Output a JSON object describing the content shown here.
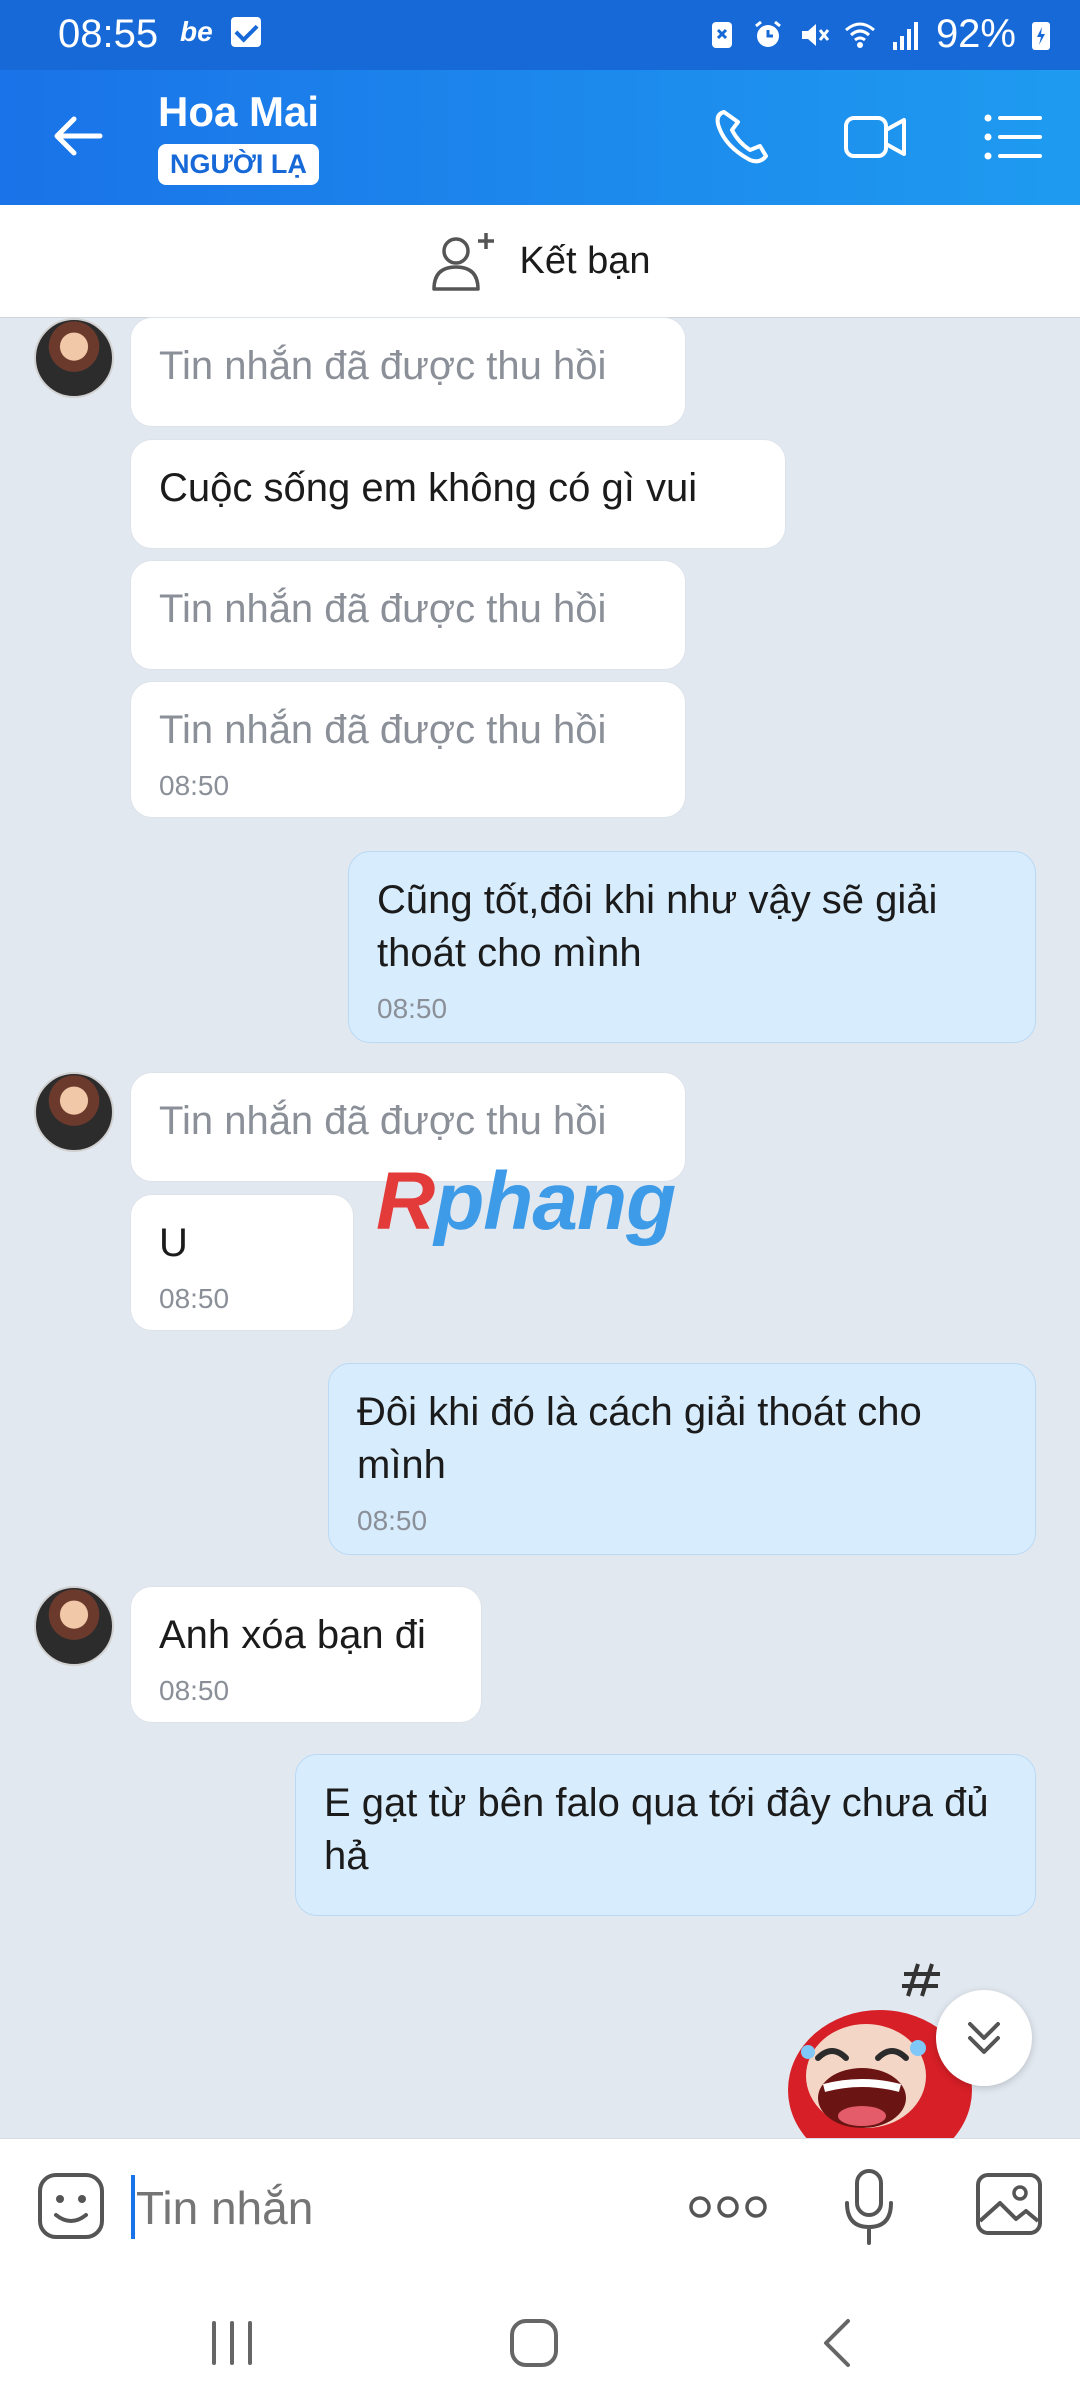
{
  "status_bar": {
    "time": "08:55",
    "be_label": "be",
    "battery": "92%"
  },
  "header": {
    "contact_name": "Hoa Mai",
    "badge": "NGƯỜI LẠ"
  },
  "friend_bar": {
    "label": "Kết bạn"
  },
  "messages": [
    {
      "side": "in",
      "text": "Tin nhắn đã được thu hồi",
      "time": "",
      "recalled": true
    },
    {
      "side": "in",
      "text": "Cuộc sống em không có gì vui",
      "time": "",
      "recalled": false
    },
    {
      "side": "in",
      "text": "Tin nhắn đã được thu hồi",
      "time": "",
      "recalled": true
    },
    {
      "side": "in",
      "text": "Tin nhắn đã được thu hồi",
      "time": "08:50",
      "recalled": true
    },
    {
      "side": "out",
      "text": "Cũng tốt,đôi khi như vậy sẽ giải thoát cho mình",
      "time": "08:50"
    },
    {
      "side": "in",
      "text": "Tin nhắn đã được thu hồi",
      "time": "",
      "recalled": true
    },
    {
      "side": "in",
      "text": "U",
      "time": "08:50",
      "recalled": false
    },
    {
      "side": "out",
      "text": "Đôi khi đó là cách giải thoát cho mình",
      "time": "08:50"
    },
    {
      "side": "in",
      "text": "Anh xóa bạn đi",
      "time": "08:50",
      "recalled": false
    },
    {
      "side": "out",
      "text": "E gạt từ bên falo qua tới đây chưa đủ hả",
      "time": ""
    }
  ],
  "watermark": {
    "first": "R",
    "rest": "phang"
  },
  "input": {
    "placeholder": "Tin nhắn"
  },
  "colors": {
    "header": "#1a73e8",
    "out_bubble": "#d7ecfd",
    "in_bubble": "#ffffff",
    "chat_bg": "#e2e8f0"
  }
}
